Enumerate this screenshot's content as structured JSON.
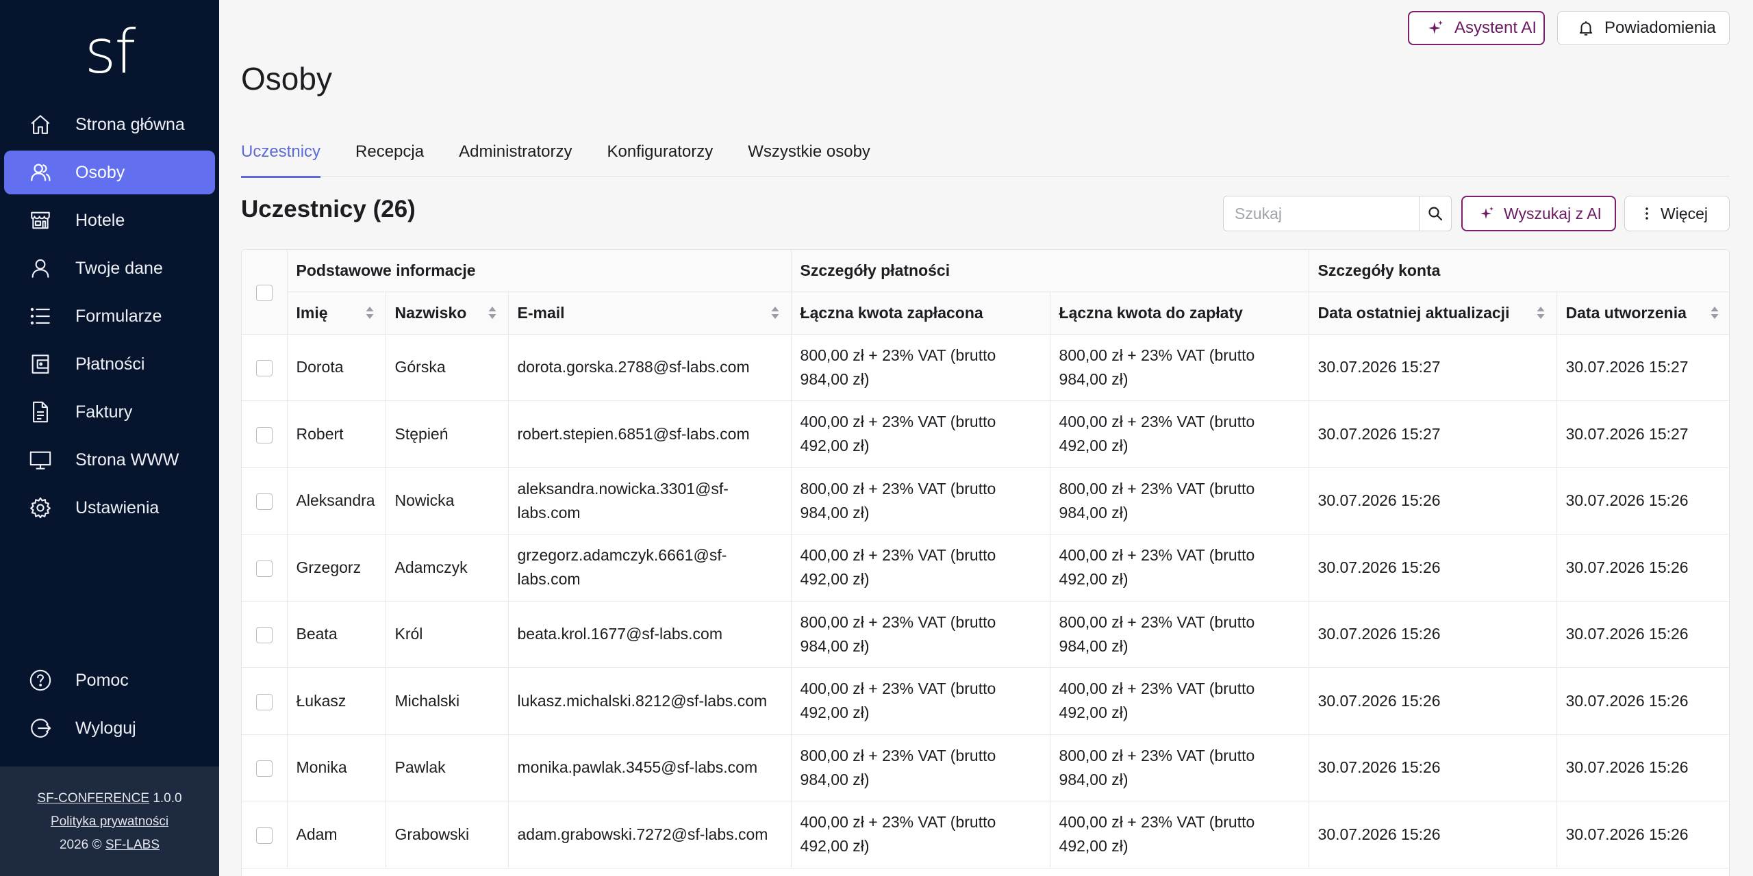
{
  "sidebar": {
    "logo": "sf",
    "nav": [
      {
        "label": "Strona główna",
        "icon": "home-icon"
      },
      {
        "label": "Osoby",
        "icon": "users-icon",
        "active": true
      },
      {
        "label": "Hotele",
        "icon": "hotel-icon"
      },
      {
        "label": "Twoje dane",
        "icon": "user-icon"
      },
      {
        "label": "Formularze",
        "icon": "list-icon"
      },
      {
        "label": "Płatności",
        "icon": "wallet-icon"
      },
      {
        "label": "Faktury",
        "icon": "document-icon"
      },
      {
        "label": "Strona WWW",
        "icon": "monitor-icon"
      },
      {
        "label": "Ustawienia",
        "icon": "gear-icon"
      }
    ],
    "bottom": [
      {
        "label": "Pomoc",
        "icon": "help-icon"
      },
      {
        "label": "Wyloguj",
        "icon": "logout-icon"
      }
    ],
    "footer": {
      "app_name": "SF-CONFERENCE",
      "version": "1.0.0",
      "privacy": "Polityka prywatności",
      "copyright_prefix": "2026 ©",
      "company": "SF-LABS"
    }
  },
  "topbar": {
    "ai_label": "Asystent AI",
    "notifications_label": "Powiadomienia"
  },
  "page": {
    "title": "Osoby",
    "tabs": [
      "Uczestnicy",
      "Recepcja",
      "Administratorzy",
      "Konfiguratorzy",
      "Wszystkie osoby"
    ],
    "active_tab": 0,
    "section_title": "Uczestnicy (26)",
    "search_placeholder": "Szukaj",
    "ai_search_label": "Wyszukaj z AI",
    "more_label": "Więcej"
  },
  "table": {
    "groups": [
      "Podstawowe informacje",
      "Szczegóły płatności",
      "Szczegóły konta"
    ],
    "columns": [
      "Imię",
      "Nazwisko",
      "E-mail",
      "Łączna kwota zapłacona",
      "Łączna kwota do zapłaty",
      "Data ostatniej aktualizacji",
      "Data utworzenia"
    ],
    "rows": [
      [
        "Dorota",
        "Górska",
        "dorota.gorska.2788@sf-labs.com",
        "800,00 zł + 23% VAT (brutto 984,00 zł)",
        "800,00 zł + 23% VAT (brutto 984,00 zł)",
        "30.07.2026 15:27",
        "30.07.2026 15:27"
      ],
      [
        "Robert",
        "Stępień",
        "robert.stepien.6851@sf-labs.com",
        "400,00 zł + 23% VAT (brutto 492,00 zł)",
        "400,00 zł + 23% VAT (brutto 492,00 zł)",
        "30.07.2026 15:27",
        "30.07.2026 15:27"
      ],
      [
        "Aleksandra",
        "Nowicka",
        "aleksandra.nowicka.3301@sf-labs.com",
        "800,00 zł + 23% VAT (brutto 984,00 zł)",
        "800,00 zł + 23% VAT (brutto 984,00 zł)",
        "30.07.2026 15:26",
        "30.07.2026 15:26"
      ],
      [
        "Grzegorz",
        "Adamczyk",
        "grzegorz.adamczyk.6661@sf-labs.com",
        "400,00 zł + 23% VAT (brutto 492,00 zł)",
        "400,00 zł + 23% VAT (brutto 492,00 zł)",
        "30.07.2026 15:26",
        "30.07.2026 15:26"
      ],
      [
        "Beata",
        "Król",
        "beata.krol.1677@sf-labs.com",
        "800,00 zł + 23% VAT (brutto 984,00 zł)",
        "800,00 zł + 23% VAT (brutto 984,00 zł)",
        "30.07.2026 15:26",
        "30.07.2026 15:26"
      ],
      [
        "Łukasz",
        "Michalski",
        "lukasz.michalski.8212@sf-labs.com",
        "400,00 zł + 23% VAT (brutto 492,00 zł)",
        "400,00 zł + 23% VAT (brutto 492,00 zł)",
        "30.07.2026 15:26",
        "30.07.2026 15:26"
      ],
      [
        "Monika",
        "Pawlak",
        "monika.pawlak.3455@sf-labs.com",
        "800,00 zł + 23% VAT (brutto 984,00 zł)",
        "800,00 zł + 23% VAT (brutto 984,00 zł)",
        "30.07.2026 15:26",
        "30.07.2026 15:26"
      ],
      [
        "Adam",
        "Grabowski",
        "adam.grabowski.7272@sf-labs.com",
        "400,00 zł + 23% VAT (brutto 492,00 zł)",
        "400,00 zł + 23% VAT (brutto 492,00 zł)",
        "30.07.2026 15:26",
        "30.07.2026 15:26"
      ]
    ]
  },
  "colors": {
    "sidebar_bg": "#06142e",
    "sidebar_active": "#6270ef",
    "accent_tab": "#5b6ad8",
    "ai_accent": "#7a1f6b"
  }
}
